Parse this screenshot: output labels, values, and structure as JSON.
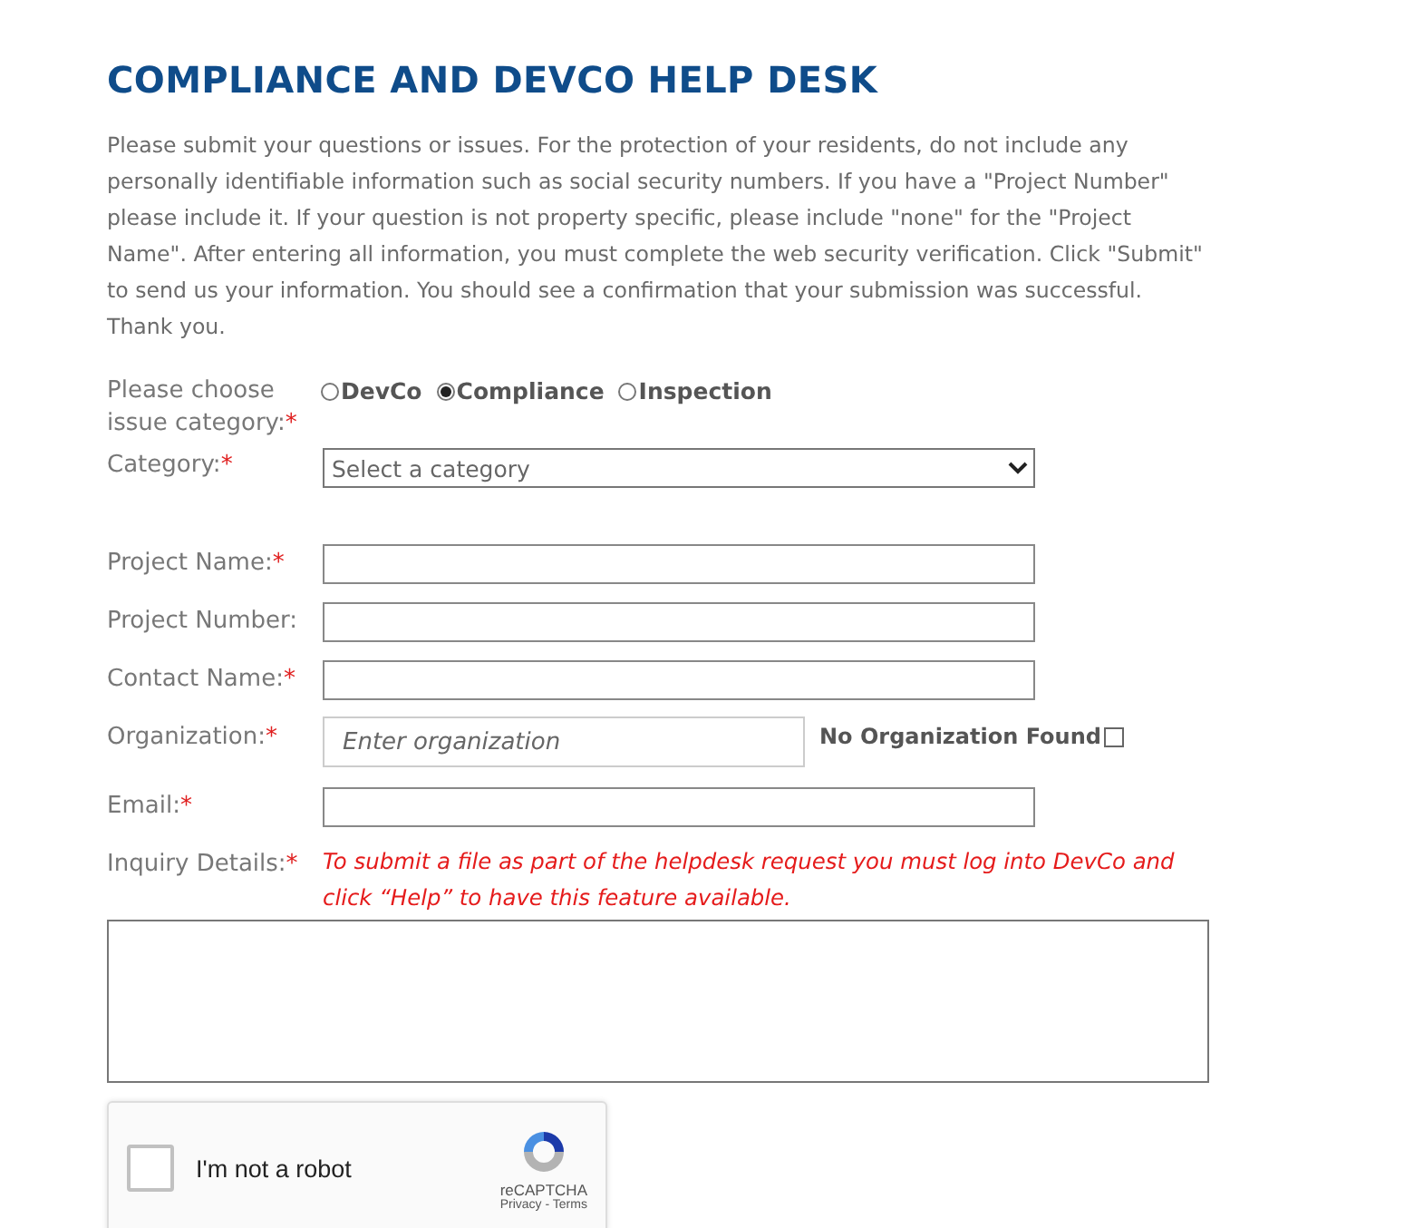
{
  "title": "COMPLIANCE AND DEVCO HELP DESK",
  "required_mark": "*",
  "intro": "Please submit your questions or issues. For the protection of your residents, do not include any personally identifiable information such as social security numbers. If you have a \"Project Number\" please include it. If your question is not property specific, please include \"none\" for the \"Project Name\". After entering all information, you must complete the web security verification. Click \"Submit\" to send us your information. You should see a confirmation that your submission was successful. Thank you.",
  "issue_category": {
    "label": "Please choose issue category:",
    "required": true,
    "options": [
      {
        "label": "DevCo",
        "selected": false
      },
      {
        "label": "Compliance",
        "selected": true
      },
      {
        "label": "Inspection",
        "selected": false
      }
    ]
  },
  "fields": [
    {
      "kind": "select",
      "label": "Category:",
      "required": true,
      "value": "Select a category"
    },
    {
      "kind": "text",
      "label": "Project Name:",
      "required": true
    },
    {
      "kind": "text",
      "label": "Project Number:",
      "required": false
    },
    {
      "kind": "text",
      "label": "Contact Name:",
      "required": true
    },
    {
      "kind": "org",
      "label": "Organization:",
      "required": true,
      "placeholder": "Enter organization",
      "checkbox": {
        "label": "No Organization Found",
        "checked": false
      }
    },
    {
      "kind": "text",
      "label": "Email:",
      "required": true
    },
    {
      "kind": "textarea",
      "label": "Inquiry Details:",
      "required": true,
      "note": "To submit a file as part of the helpdesk request you must log into DevCo and click “Help” to have this feature available."
    }
  ],
  "captcha": {
    "label": "I'm not a robot",
    "checked": false,
    "brand": "reCAPTCHA",
    "links": "Privacy - Terms"
  }
}
